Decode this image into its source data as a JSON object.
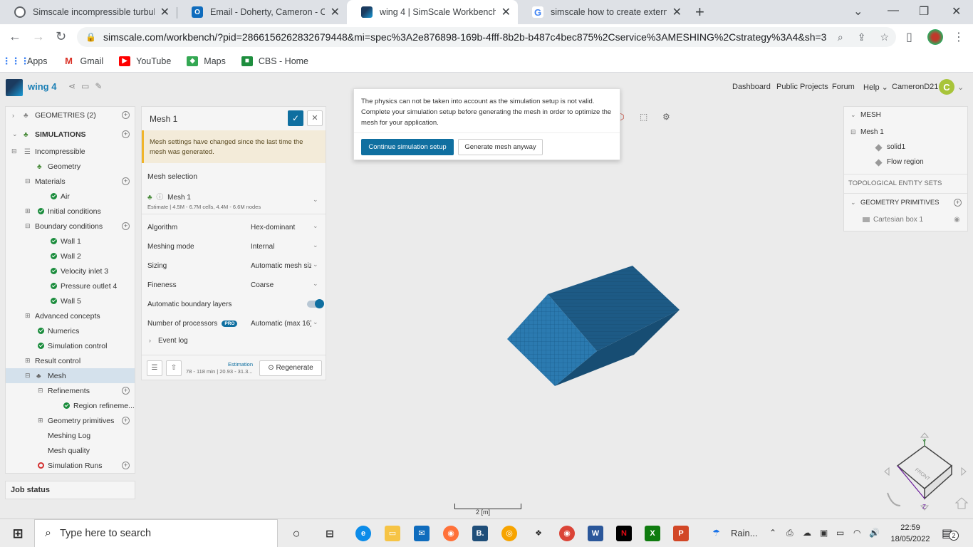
{
  "browser": {
    "tabs": [
      {
        "title": "Simscale incompressible turbulen",
        "icon": "simscale-forum-icon",
        "color": "#5f6368"
      },
      {
        "title": "Email - Doherty, Cameron - Outlo",
        "icon": "outlook-icon",
        "color": "#0f6cbd"
      },
      {
        "title": "wing 4 | SimScale Workbench",
        "icon": "simscale-icon",
        "color": "#1b3b5f"
      },
      {
        "title": "simscale how to create external f",
        "icon": "google-icon",
        "color": "#4285f4"
      }
    ],
    "url": "simscale.com/workbench/?pid=2866156262832679448&mi=spec%3A2e876898-169b-4fff-8b2b-b487c4bec875%2Cservice%3AMESHING%2Cstrategy%3A4&sh=3",
    "bookmarks": [
      {
        "label": "Apps",
        "icon": "apps-grid-icon",
        "color": "#4285f4"
      },
      {
        "label": "Gmail",
        "icon": "gmail-icon",
        "color": "#d93025"
      },
      {
        "label": "YouTube",
        "icon": "youtube-icon",
        "color": "#ff0000"
      },
      {
        "label": "Maps",
        "icon": "maps-icon",
        "color": "#34a853"
      },
      {
        "label": "CBS - Home",
        "icon": "cbs-icon",
        "color": "#1e8e3e"
      }
    ]
  },
  "app": {
    "project": "wing 4",
    "nav": [
      "Dashboard",
      "Public Projects",
      "Forum",
      "Help",
      "CameronD21"
    ],
    "user_initial": "C"
  },
  "tree": {
    "geometries": "GEOMETRIES (2)",
    "simulations": "SIMULATIONS",
    "items": [
      {
        "label": "Incompressible"
      },
      {
        "label": "Geometry"
      },
      {
        "label": "Materials"
      },
      {
        "label": "Air"
      },
      {
        "label": "Initial conditions"
      },
      {
        "label": "Boundary conditions"
      },
      {
        "label": "Wall 1"
      },
      {
        "label": "Wall 2"
      },
      {
        "label": "Velocity inlet 3"
      },
      {
        "label": "Pressure outlet 4"
      },
      {
        "label": "Wall 5"
      },
      {
        "label": "Advanced concepts"
      },
      {
        "label": "Numerics"
      },
      {
        "label": "Simulation control"
      },
      {
        "label": "Result control"
      },
      {
        "label": "Mesh"
      },
      {
        "label": "Refinements"
      },
      {
        "label": "Region refineme..."
      },
      {
        "label": "Geometry primitives"
      },
      {
        "label": "Meshing Log"
      },
      {
        "label": "Mesh quality"
      },
      {
        "label": "Simulation Runs"
      }
    ],
    "job_status": "Job status"
  },
  "mesh_panel": {
    "title": "Mesh 1",
    "warning": "Mesh settings have changed since the last time the mesh was generated.",
    "section": "Mesh selection",
    "mesh_name": "Mesh 1",
    "estimate": "Estimate | 4.5M - 6.7M cells, 4.4M - 6.6M nodes",
    "rows": [
      {
        "label": "Algorithm",
        "value": "Hex-dominant"
      },
      {
        "label": "Meshing mode",
        "value": "Internal"
      },
      {
        "label": "Sizing",
        "value": "Automatic mesh sizi"
      },
      {
        "label": "Fineness",
        "value": "Coarse"
      }
    ],
    "boundary_layers": "Automatic boundary layers",
    "boundary_layers_on": true,
    "processors_label": "Number of processors",
    "pro_badge": "PRO",
    "processors_value": "Automatic (max 16)",
    "event_log": "Event log",
    "estimation_label": "Estimation",
    "estimation_value": "78 - 118 min | 20.93 - 31.3...",
    "regenerate": "Regenerate"
  },
  "dialog": {
    "message": "The physics can not be taken into account as the simulation setup is not valid. Complete your simulation setup before generating the mesh in order to optimize the mesh for your application.",
    "primary": "Continue simulation setup",
    "secondary": "Generate mesh anyway"
  },
  "right_panel": {
    "mesh_header": "MESH",
    "mesh_item": "Mesh 1",
    "children": [
      "solid1",
      "Flow region"
    ],
    "topological": "TOPOLOGICAL ENTITY SETS",
    "primitives": "GEOMETRY PRIMITIVES",
    "primitive_item": "Cartesian box 1"
  },
  "viewer": {
    "scale_label": "2 [m]",
    "cube_label": "FRONT",
    "mesh_color": "#1d5a85"
  },
  "taskbar": {
    "search_placeholder": "Type here to search",
    "weather": "Rain...",
    "time": "22:59",
    "date": "18/05/2022",
    "notifications": "2"
  }
}
